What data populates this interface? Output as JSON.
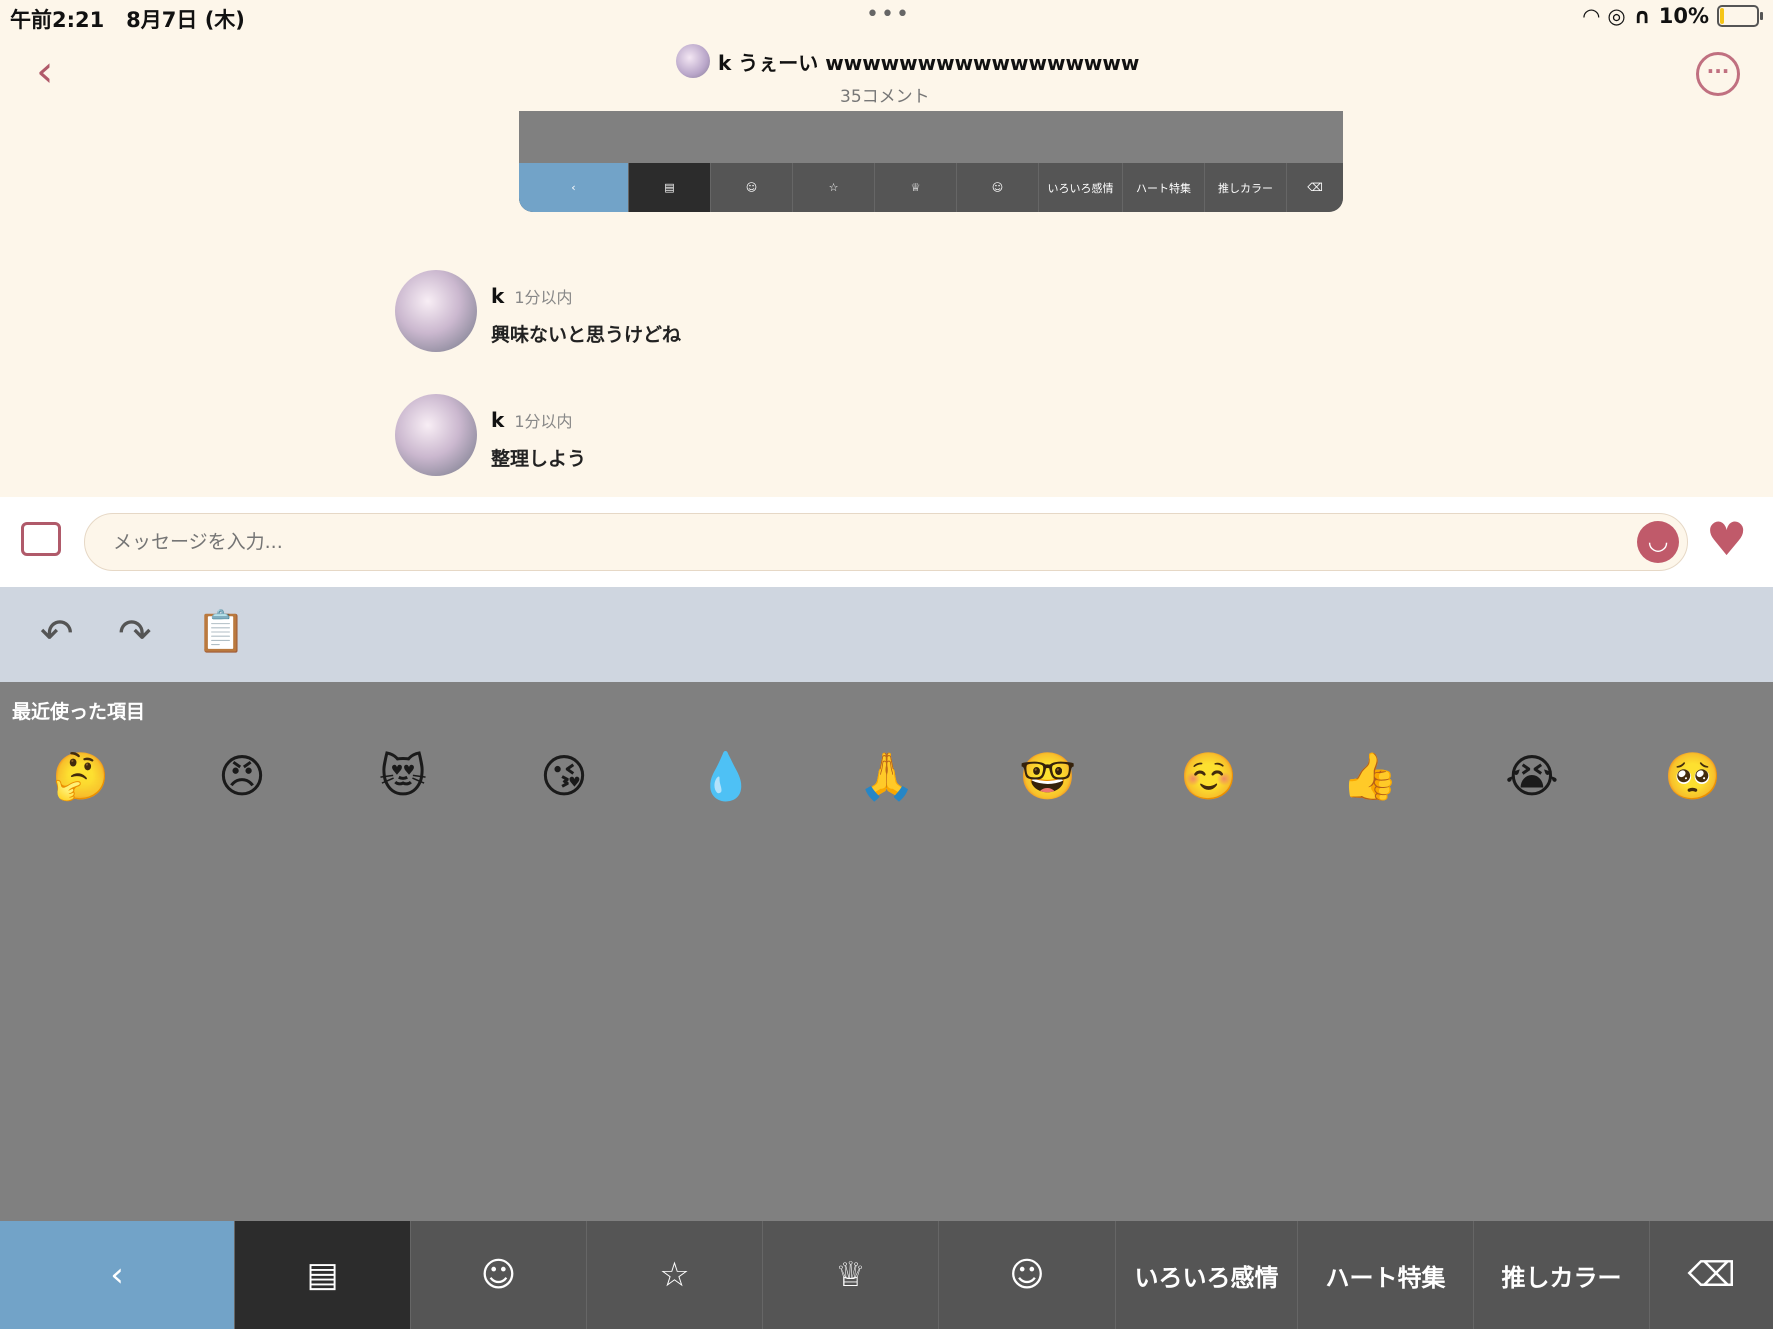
{
  "status": {
    "time": "午前2:21",
    "date": "8月7日 (木)",
    "dots": "•••",
    "battery": "10%",
    "battery_level": 0.1
  },
  "header": {
    "back_icon": "chevron-left-icon",
    "user": "k",
    "title": "うぇーい wwwwwwwwwwwwwwwww",
    "comment_count": "35コメント",
    "more_icon": "ellipsis-circle-icon"
  },
  "mini_keyboard": {
    "tabs": [
      "いろいろ感情",
      "ハート特集",
      "推しカラー"
    ]
  },
  "comments": [
    {
      "name": "k",
      "time": "1分以内",
      "text": "興味ないと思うけどね"
    },
    {
      "name": "k",
      "time": "1分以内",
      "text": "整理しよう"
    }
  ],
  "input": {
    "placeholder": "メッセージを入力..."
  },
  "keyboard": {
    "recent_label": "最近使った項目",
    "recent_emojis": [
      "🤔",
      "😠",
      "😻",
      "😘",
      "💧",
      "🙏",
      "🤓",
      "☺️",
      "👍",
      "😭",
      "🥺"
    ],
    "tabs": [
      "いろいろ感情",
      "ハート特集",
      "推しカラー"
    ],
    "colors": {
      "back_tab": "#72a3c8",
      "active_tab": "#2c2c2c",
      "bar": "#555555"
    }
  }
}
